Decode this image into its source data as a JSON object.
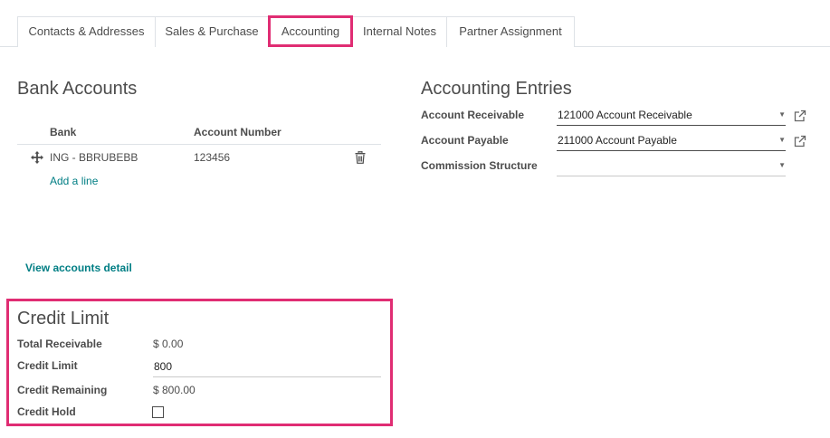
{
  "tabs": [
    {
      "label": "Contacts & Addresses"
    },
    {
      "label": "Sales & Purchase"
    },
    {
      "label": "Accounting"
    },
    {
      "label": "Internal Notes"
    },
    {
      "label": "Partner Assignment"
    }
  ],
  "bank_accounts": {
    "title": "Bank Accounts",
    "columns": [
      "Bank",
      "Account Number"
    ],
    "rows": [
      {
        "bank": "ING - BBRUBEBB",
        "account_number": "123456"
      }
    ],
    "add_line": "Add a line",
    "view_detail": "View accounts detail"
  },
  "accounting_entries": {
    "title": "Accounting Entries",
    "fields": [
      {
        "label": "Account Receivable",
        "value": "121000 Account Receivable"
      },
      {
        "label": "Account Payable",
        "value": "211000 Account Payable"
      },
      {
        "label": "Commission Structure",
        "value": ""
      }
    ]
  },
  "credit_limit": {
    "title": "Credit Limit",
    "total_receivable_label": "Total Receivable",
    "total_receivable_value": "$ 0.00",
    "credit_limit_label": "Credit Limit",
    "credit_limit_value": "800",
    "credit_remaining_label": "Credit Remaining",
    "credit_remaining_value": "$ 800.00",
    "credit_hold_label": "Credit Hold",
    "credit_hold_checked": false
  },
  "colors": {
    "accent_highlight": "#e02d73",
    "link": "#017e84",
    "text": "#4c4c4c",
    "border": "#dee2e6"
  }
}
